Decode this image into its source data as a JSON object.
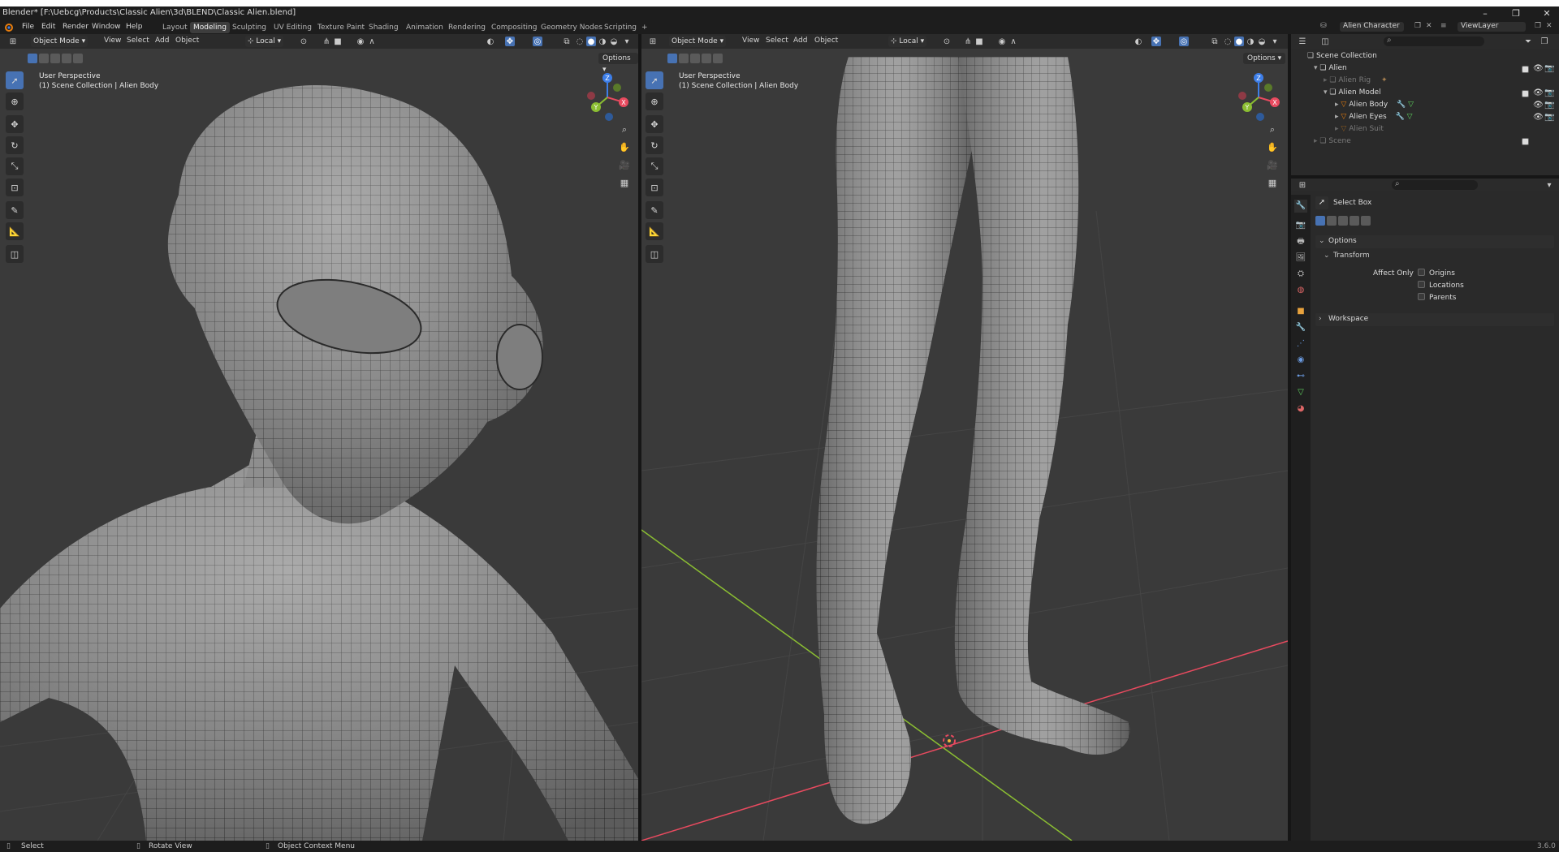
{
  "window": {
    "title": "Blender* [F:\\Uebcg\\Products\\Classic Alien\\3d\\BLEND\\Classic Alien.blend]"
  },
  "menu": [
    "File",
    "Edit",
    "Render",
    "Window",
    "Help"
  ],
  "workspaces": {
    "tabs": [
      "Layout",
      "Modeling",
      "Sculpting",
      "UV Editing",
      "Texture Paint",
      "Shading",
      "Animation",
      "Rendering",
      "Compositing",
      "Geometry Nodes",
      "Scripting"
    ],
    "active": "Modeling",
    "add": "+"
  },
  "scene": {
    "name": "Alien Character",
    "view_layer": "ViewLayer"
  },
  "viewport_left": {
    "mode": "Object Mode",
    "menus": [
      "View",
      "Select",
      "Add",
      "Object"
    ],
    "orientation": "Local",
    "info_line1": "User Perspective",
    "info_line2": "(1) Scene Collection | Alien Body",
    "options": "Options"
  },
  "viewport_right": {
    "mode": "Object Mode",
    "menus": [
      "View",
      "Select",
      "Add",
      "Object"
    ],
    "orientation": "Local",
    "info_line1": "User Perspective",
    "info_line2": "(1) Scene Collection | Alien Body",
    "options": "Options"
  },
  "gizmo": {
    "z": "Z",
    "y": "Y",
    "x": "X"
  },
  "outliner": {
    "root": "Scene Collection",
    "rows": [
      {
        "label": "Alien",
        "dim": false
      },
      {
        "label": "Alien Rig",
        "dim": true
      },
      {
        "label": "Alien Model",
        "dim": false
      },
      {
        "label": "Alien Body",
        "dim": false
      },
      {
        "label": "Alien Eyes",
        "dim": false
      },
      {
        "label": "Alien Suit",
        "dim": true
      },
      {
        "label": "Scene",
        "dim": true
      }
    ]
  },
  "properties": {
    "tool": "Select Box",
    "sections": {
      "options": "Options",
      "transform": "Transform",
      "workspace": "Workspace"
    },
    "affect_only": "Affect Only",
    "checkboxes": [
      "Origins",
      "Locations",
      "Parents"
    ]
  },
  "status": {
    "select": "Select",
    "rotate": "Rotate View",
    "context": "Object Context Menu",
    "version": "3.6.0"
  },
  "colors": {
    "accent": "#4772b3",
    "axis_x": "#e84a5f",
    "axis_y": "#8bbe32",
    "axis_z": "#3d7ee8",
    "viewport_bg": "#3a3a3a",
    "header_bg": "#2b2b2b"
  }
}
